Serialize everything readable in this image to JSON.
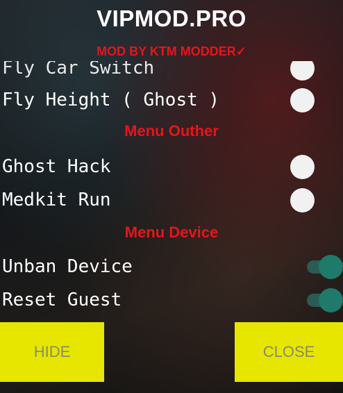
{
  "header": {
    "title": "VIPMOD.PRO",
    "subtitle": "MOD BY KTM MODDER✓"
  },
  "menu": {
    "partial_item": {
      "label": "Fly Car Switch",
      "state": "off"
    },
    "items_top": [
      {
        "label": "Fly Height ( Ghost )",
        "state": "off"
      }
    ],
    "section_outher": "Menu Outher",
    "items_outher": [
      {
        "label": "Ghost Hack",
        "state": "off"
      },
      {
        "label": "Medkit Run",
        "state": "off"
      }
    ],
    "section_device": "Menu Device",
    "items_device": [
      {
        "label": "Unban Device",
        "state": "on"
      },
      {
        "label": "Reset Guest",
        "state": "on"
      }
    ]
  },
  "buttons": {
    "hide": "HIDE",
    "close": "CLOSE"
  },
  "colors": {
    "accent_red": "#e8141b",
    "button_yellow": "#e6e600",
    "toggle_on": "#1f7a6a",
    "toggle_off": "#f1f1f1"
  }
}
